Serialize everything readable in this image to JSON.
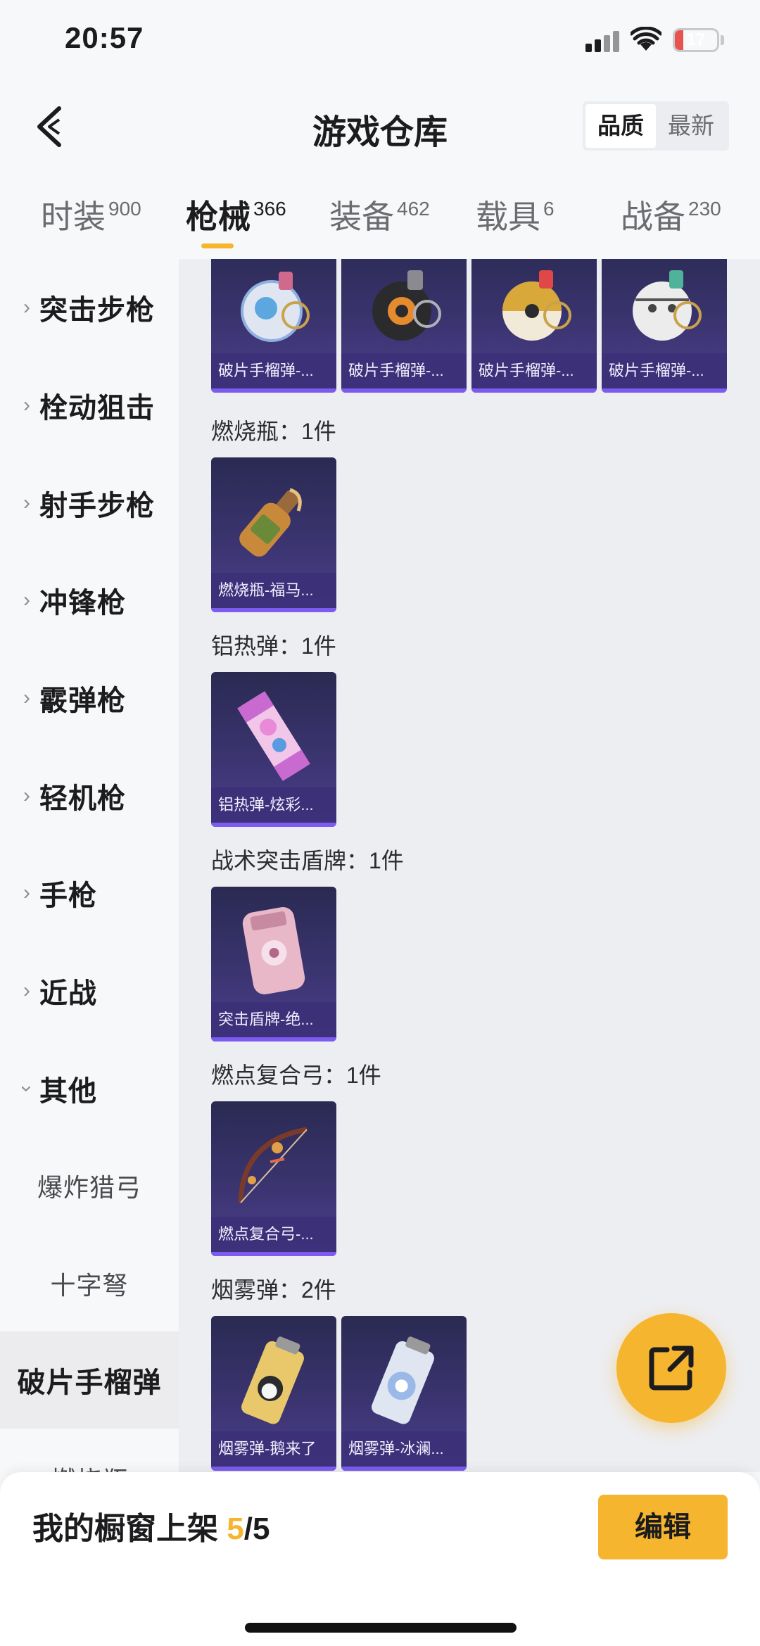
{
  "status_bar": {
    "time": "20:57",
    "battery_level": "17",
    "battery_fraction": 0.17
  },
  "header": {
    "title": "游戏仓库",
    "sort_options": [
      "品质",
      "最新"
    ],
    "active_sort": 0
  },
  "tabs": [
    {
      "label": "时装",
      "count": "900"
    },
    {
      "label": "枪械",
      "count": "366"
    },
    {
      "label": "装备",
      "count": "462"
    },
    {
      "label": "载具",
      "count": "6"
    },
    {
      "label": "战备",
      "count": "230"
    }
  ],
  "active_tab": 1,
  "sidebar": {
    "items": [
      "突击步枪",
      "栓动狙击",
      "射手步枪",
      "冲锋枪",
      "霰弹枪",
      "轻机枪",
      "手枪",
      "近战",
      "其他"
    ],
    "sub_items": [
      "爆炸猎弓",
      "十字弩"
    ],
    "active_item": "破片手榴弹",
    "cut_off_item": "燃烧瓶"
  },
  "groups": [
    {
      "title": "",
      "items": [
        "破片手榴弹-...",
        "破片手榴弹-...",
        "破片手榴弹-...",
        "破片手榴弹-..."
      ]
    },
    {
      "title": "燃烧瓶：1件",
      "items": [
        "燃烧瓶-福马..."
      ]
    },
    {
      "title": "铝热弹：1件",
      "items": [
        "铝热弹-炫彩..."
      ]
    },
    {
      "title": "战术突击盾牌：1件",
      "items": [
        "突击盾牌-绝..."
      ]
    },
    {
      "title": "燃点复合弓：1件",
      "items": [
        "燃点复合弓-..."
      ]
    },
    {
      "title": "烟雾弹：2件",
      "items": [
        "烟雾弹-鹅来了",
        "烟雾弹-冰澜..."
      ]
    }
  ],
  "bottom_bar": {
    "label": "我的橱窗上架",
    "used": "5",
    "total": "/5",
    "edit_label": "编辑"
  },
  "colors": {
    "accent": "#f5b52e",
    "card_purple": "#3b3470",
    "card_edge": "#7c5cf0",
    "battery_red": "#e5544f"
  },
  "icons": {
    "back": "chevron-left-icon",
    "share": "share-external-icon",
    "signal": "signal-icon",
    "wifi": "wifi-icon",
    "battery": "battery-icon"
  }
}
